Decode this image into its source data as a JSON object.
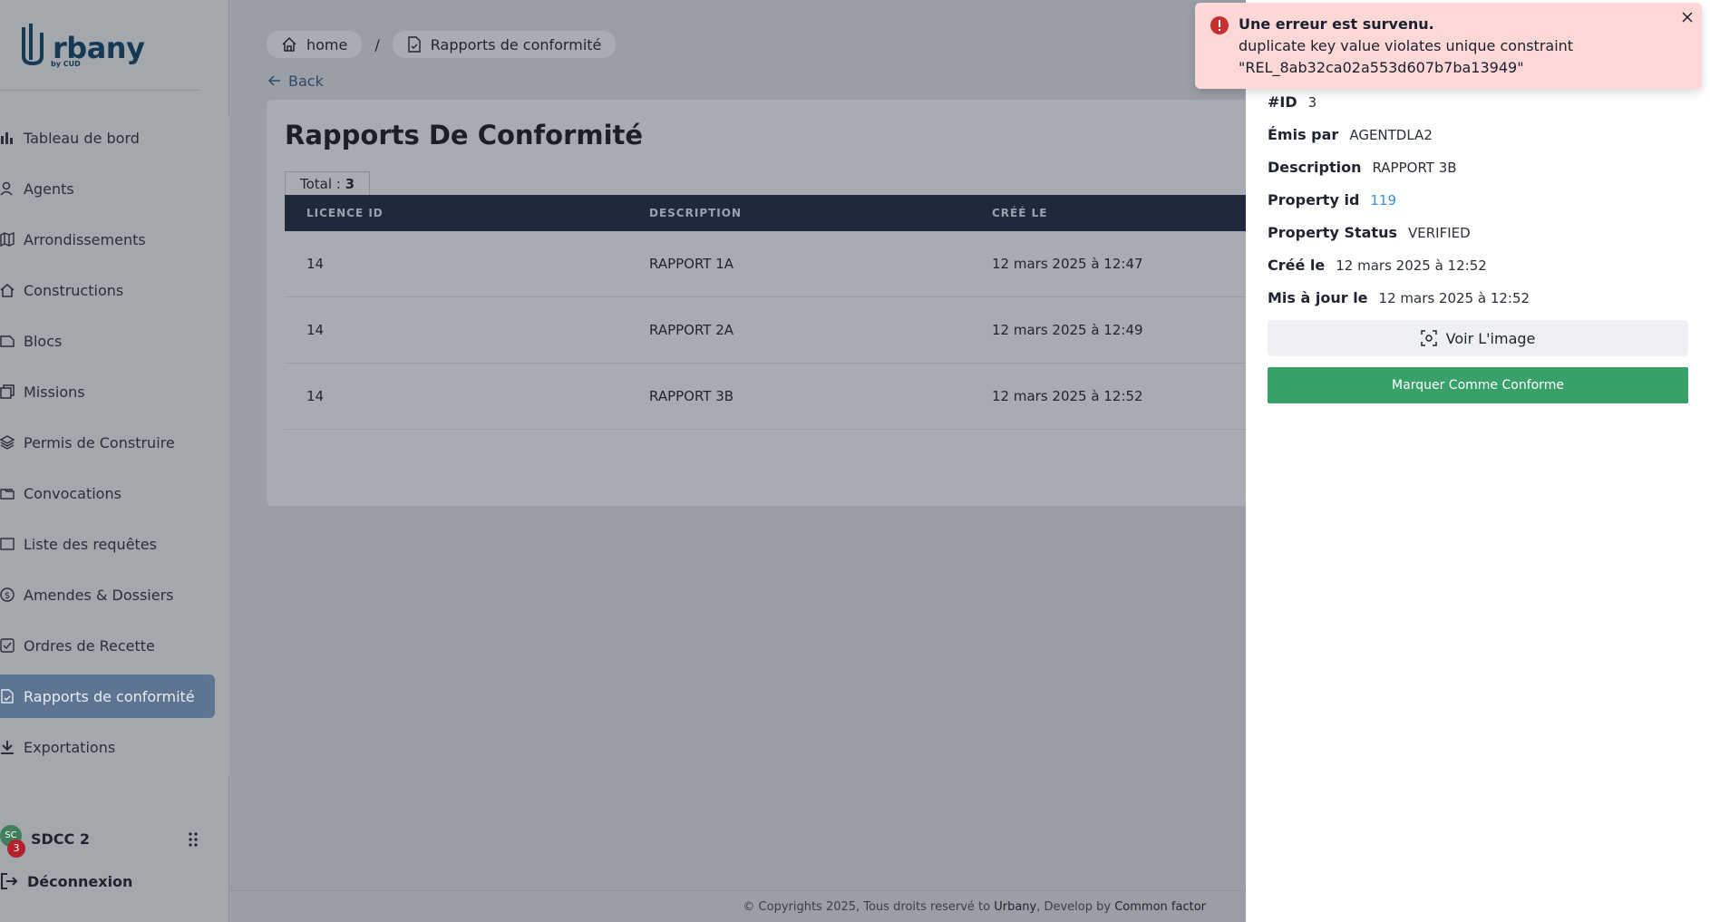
{
  "app": {
    "logo_text": "rbany",
    "logo_sub": "by CUD"
  },
  "sidebar": {
    "items": [
      {
        "label": "Tableau de bord",
        "icon": "bar-chart-icon"
      },
      {
        "label": "Agents",
        "icon": "user-icon"
      },
      {
        "label": "Arrondissements",
        "icon": "map-icon"
      },
      {
        "label": "Constructions",
        "icon": "home-icon"
      },
      {
        "label": "Blocs",
        "icon": "block-icon"
      },
      {
        "label": "Missions",
        "icon": "missions-icon"
      },
      {
        "label": "Permis de Construire",
        "icon": "layers-icon"
      },
      {
        "label": "Convocations",
        "icon": "folder-icon"
      },
      {
        "label": "Liste des requêtes",
        "icon": "list-icon"
      },
      {
        "label": "Amendes & Dossiers",
        "icon": "dollar-icon"
      },
      {
        "label": "Ordres de Recette",
        "icon": "receipt-icon"
      },
      {
        "label": "Rapports de conformité",
        "icon": "file-check-icon",
        "active": true
      },
      {
        "label": "Exportations",
        "icon": "download-icon"
      }
    ],
    "user": {
      "name": "SDCC 2",
      "initials": "SC",
      "notifications": "3"
    },
    "logout_label": "Déconnexion"
  },
  "breadcrumb": {
    "home": "home",
    "separator": "/",
    "current": "Rapports de conformité"
  },
  "back_label": "Back",
  "page": {
    "title": "Rapports De Conformité",
    "total_label": "Total : ",
    "total_value": "3"
  },
  "table": {
    "headers": [
      "LICENCE ID",
      "DESCRIPTION",
      "CRÉÉ LE"
    ],
    "rows": [
      [
        "14",
        "RAPPORT 1A",
        "12 mars 2025 à 12:47"
      ],
      [
        "14",
        "RAPPORT 2A",
        "12 mars 2025 à 12:49"
      ],
      [
        "14",
        "RAPPORT 3B",
        "12 mars 2025 à 12:52"
      ]
    ]
  },
  "footer": {
    "prefix": "© Copyrights 2025, Tous droits reservé to ",
    "brand": "Urbany",
    "mid": ", Develop by ",
    "dev": "Common factor"
  },
  "panel": {
    "fields": [
      {
        "key": "#ID",
        "value": "3"
      },
      {
        "key": "Émis par",
        "value": "AGENTDLA2"
      },
      {
        "key": "Description",
        "value": "RAPPORT 3B"
      },
      {
        "key": "Property id",
        "value": "119"
      },
      {
        "key": "Property Status",
        "value": "VERIFIED"
      },
      {
        "key": "Créé le",
        "value": "12 mars 2025 à 12:52"
      },
      {
        "key": "Mis à jour le",
        "value": "12 mars 2025 à 12:52"
      }
    ],
    "view_image_label": "Voir L'image",
    "mark_conforme_label": "Marquer Comme Conforme"
  },
  "toast": {
    "title": "Une erreur est survenu.",
    "message_line1": "duplicate key value violates unique constraint",
    "message_line2": "\"REL_8ab32ca02a553d607b7ba13949\""
  },
  "colors": {
    "active_nav": "#5d7592",
    "table_header": "#1e2a3b",
    "success": "#38a169",
    "toast_bg": "#fed7d7",
    "error_icon": "#c53030",
    "link": "#3b8fd6"
  }
}
